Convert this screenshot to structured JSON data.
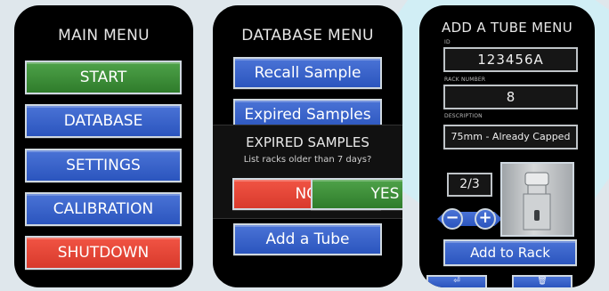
{
  "main_menu": {
    "title": "MAIN MENU",
    "buttons": [
      "START",
      "DATABASE",
      "SETTINGS",
      "CALIBRATION",
      "SHUTDOWN"
    ]
  },
  "database_menu": {
    "title": "DATABASE MENU",
    "buttons": [
      "Recall Sample",
      "Expired Samples",
      "Add a Tube"
    ],
    "dialog": {
      "title": "EXPIRED SAMPLES",
      "message": "List racks older than 7 days?",
      "no_label": "NO",
      "yes_label": "YES"
    }
  },
  "add_tube_menu": {
    "title": "ADD A TUBE MENU",
    "id_label": "ID",
    "id_value": "123456A",
    "rack_label": "RACK NUMBER",
    "rack_value": "8",
    "desc_label": "DESCRIPTION",
    "desc_value": "75mm - Already Capped",
    "counter": "2/3",
    "minus": "−",
    "plus": "+",
    "add_button": "Add to Rack",
    "nav_icons": [
      "back-icon",
      "trash-icon"
    ]
  },
  "colors": {
    "blue": "#3461c8",
    "green": "#3f8f3a",
    "red": "#e8473a",
    "panel": "#000000"
  }
}
